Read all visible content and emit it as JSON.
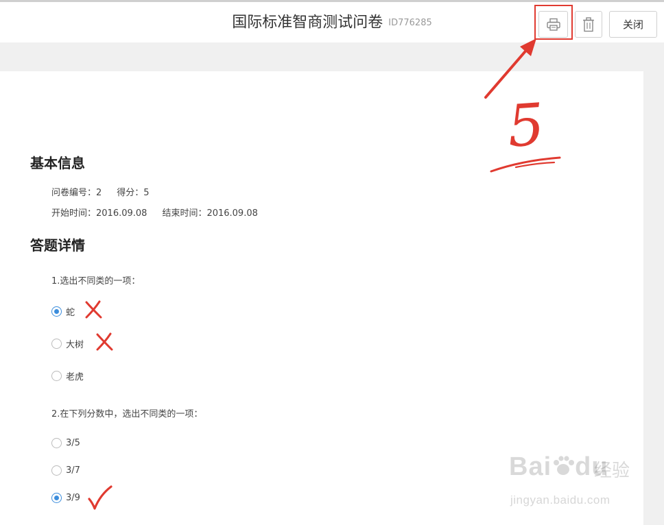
{
  "header": {
    "title": "国际标准智商测试问卷",
    "id_label": "ID776285",
    "close_label": "关闭",
    "print_icon": "printer-icon",
    "delete_icon": "trash-icon"
  },
  "annotation": {
    "step_number": "5",
    "color": "#e03a30"
  },
  "basic_info": {
    "title": "基本信息",
    "survey_no": "问卷编号：2",
    "score": "得分：5",
    "start_time": "开始时间：2016.09.08",
    "end_time": "结束时间：2016.09.08"
  },
  "answers": {
    "title": "答题详情",
    "questions": [
      {
        "text": "1.选出不同类的一项：",
        "options": [
          {
            "label": "蛇",
            "checked": true,
            "mark": "cross"
          },
          {
            "label": "大树",
            "checked": false,
            "mark": "cross"
          },
          {
            "label": "老虎",
            "checked": false,
            "mark": ""
          }
        ]
      },
      {
        "text": "2.在下列分数中，选出不同类的一项：",
        "options": [
          {
            "label": "3/5",
            "checked": false,
            "mark": ""
          },
          {
            "label": "3/7",
            "checked": false,
            "mark": ""
          },
          {
            "label": "3/9",
            "checked": true,
            "mark": "check"
          }
        ]
      }
    ]
  },
  "watermark": {
    "brand": "Bai",
    "brand2": "du",
    "cn": "经验",
    "url": "jingyan.baidu.com"
  },
  "colors": {
    "accent": "#3c8ddc",
    "mark_red": "#e03a30"
  }
}
